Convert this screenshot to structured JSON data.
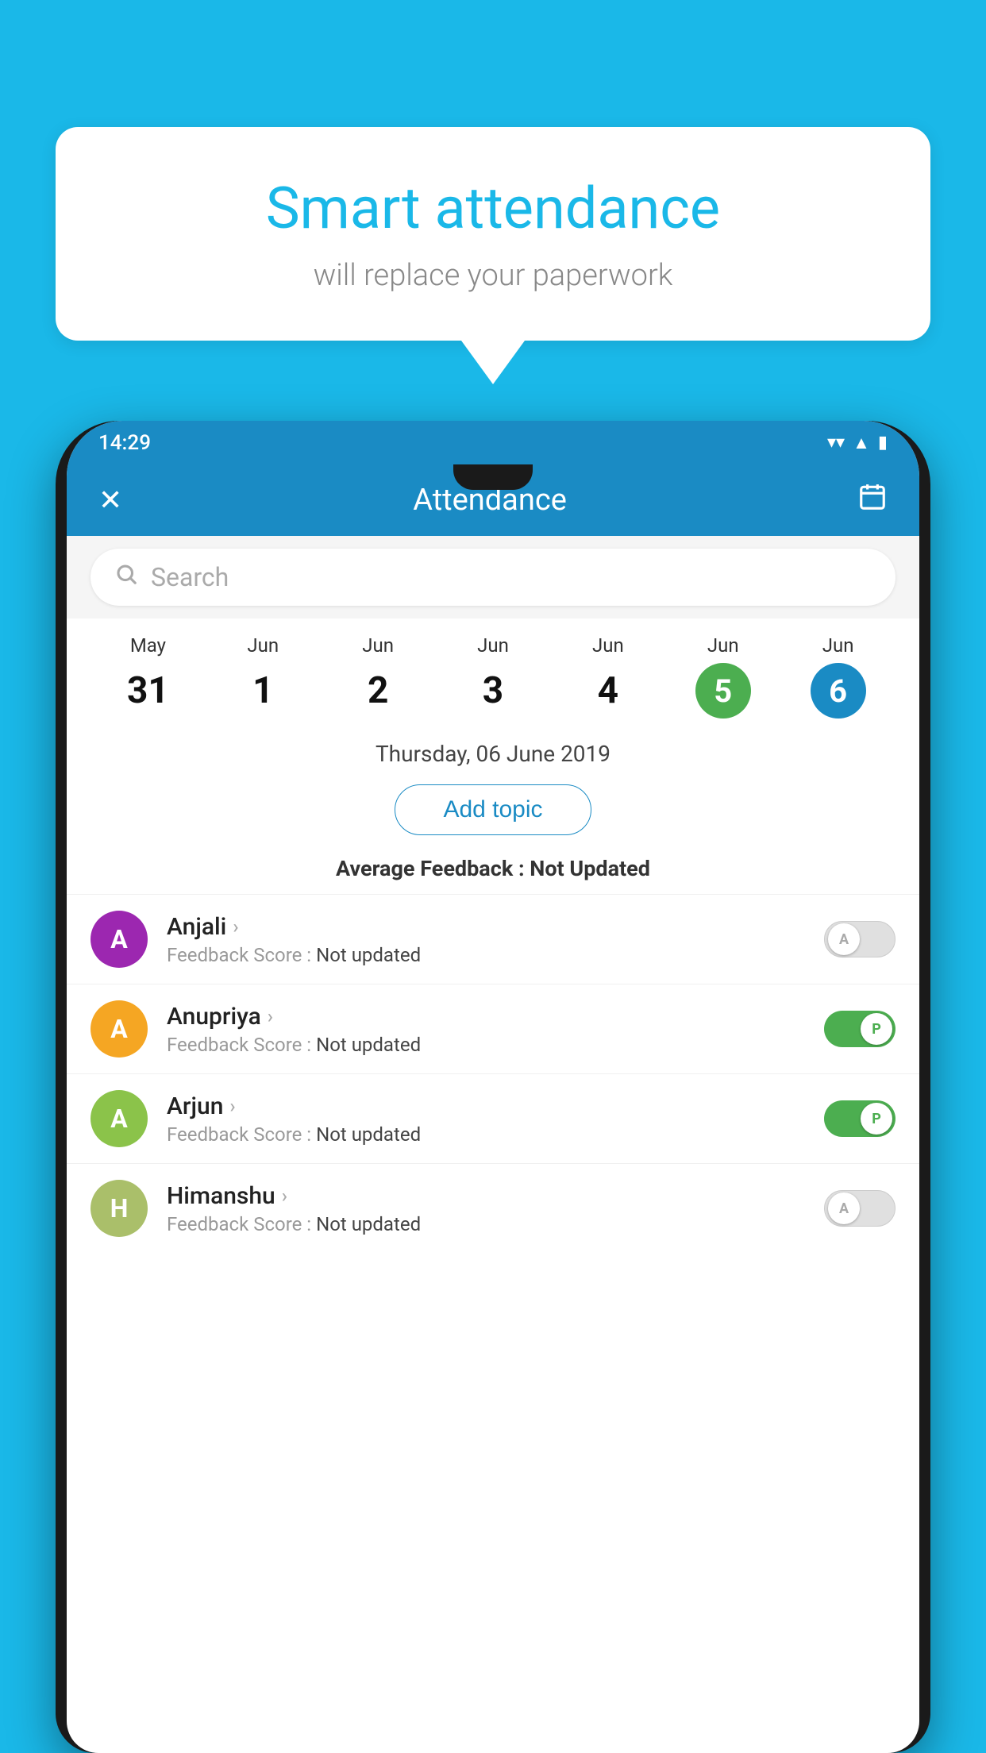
{
  "background_color": "#1ab8e8",
  "speech_bubble": {
    "title": "Smart attendance",
    "subtitle": "will replace your paperwork"
  },
  "status_bar": {
    "time": "14:29",
    "wifi_icon": "▼",
    "signal_icon": "▲",
    "battery_icon": "▮"
  },
  "app_header": {
    "close_icon": "✕",
    "title": "Attendance",
    "calendar_icon": "📅"
  },
  "search": {
    "placeholder": "Search"
  },
  "calendar": {
    "days": [
      {
        "month": "May",
        "date": "31",
        "style": "normal"
      },
      {
        "month": "Jun",
        "date": "1",
        "style": "normal"
      },
      {
        "month": "Jun",
        "date": "2",
        "style": "normal"
      },
      {
        "month": "Jun",
        "date": "3",
        "style": "normal"
      },
      {
        "month": "Jun",
        "date": "4",
        "style": "normal"
      },
      {
        "month": "Jun",
        "date": "5",
        "style": "today-green"
      },
      {
        "month": "Jun",
        "date": "6",
        "style": "selected-blue"
      }
    ]
  },
  "selected_date": "Thursday, 06 June 2019",
  "add_topic_label": "Add topic",
  "avg_feedback_label": "Average Feedback :",
  "avg_feedback_value": "Not Updated",
  "students": [
    {
      "name": "Anjali",
      "initial": "A",
      "avatar_color": "#9c27b0",
      "feedback_label": "Feedback Score :",
      "feedback_value": "Not updated",
      "toggle": "off",
      "toggle_letter": "A"
    },
    {
      "name": "Anupriya",
      "initial": "A",
      "avatar_color": "#f5a623",
      "feedback_label": "Feedback Score :",
      "feedback_value": "Not updated",
      "toggle": "on",
      "toggle_letter": "P"
    },
    {
      "name": "Arjun",
      "initial": "A",
      "avatar_color": "#8bc34a",
      "feedback_label": "Feedback Score :",
      "feedback_value": "Not updated",
      "toggle": "on",
      "toggle_letter": "P"
    },
    {
      "name": "Himanshu",
      "initial": "H",
      "avatar_color": "#aabf6a",
      "feedback_label": "Feedback Score :",
      "feedback_value": "Not updated",
      "toggle": "off",
      "toggle_letter": "A"
    }
  ]
}
